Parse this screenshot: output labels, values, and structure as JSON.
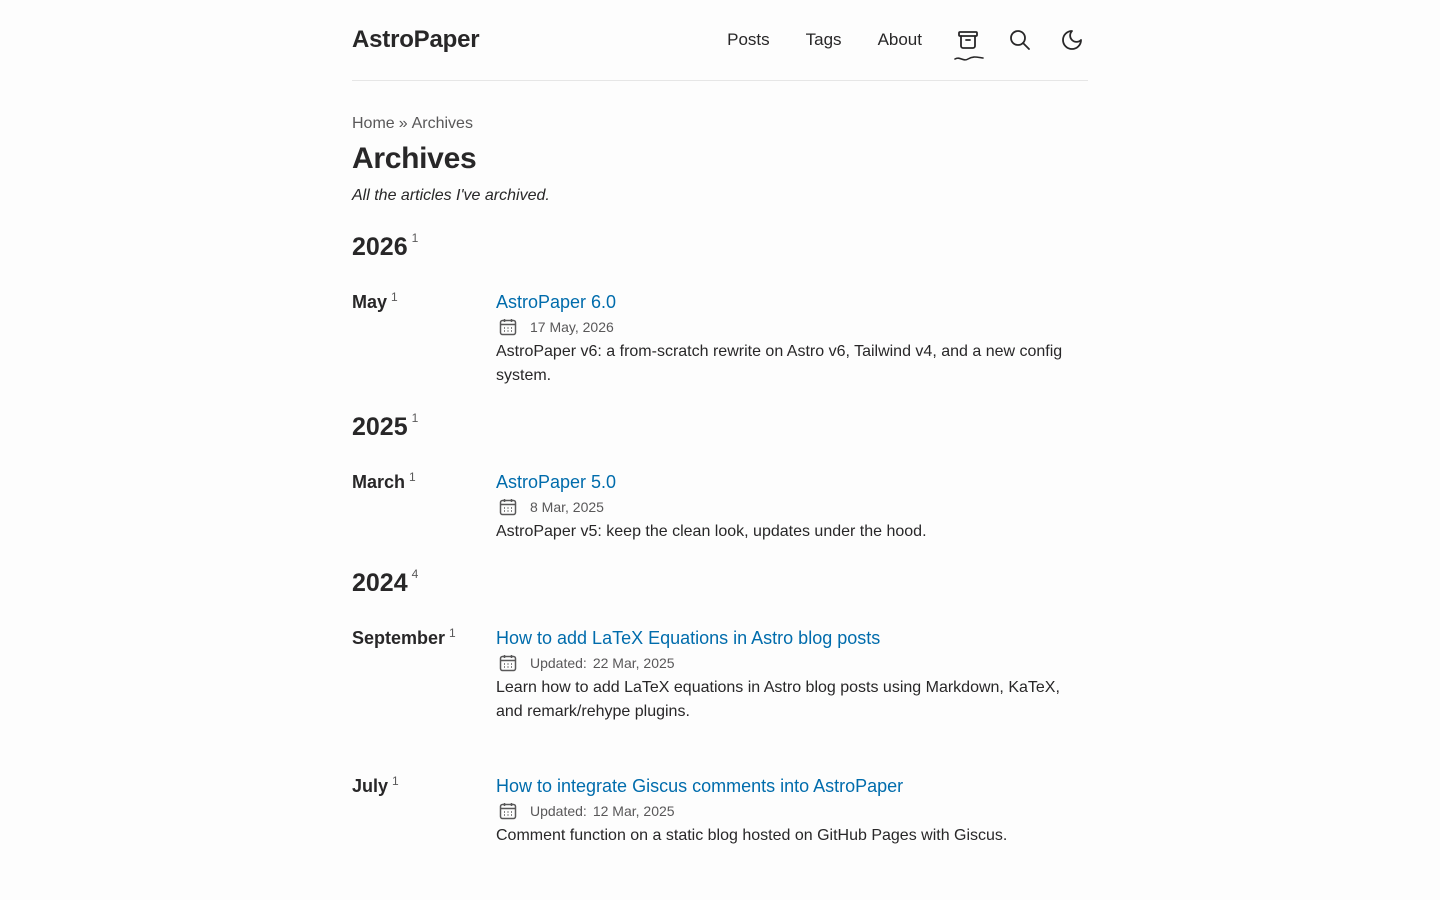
{
  "header": {
    "logo": "AstroPaper",
    "nav": {
      "posts": "Posts",
      "tags": "Tags",
      "about": "About"
    },
    "icons": [
      "archive-icon",
      "search-icon",
      "moon-icon"
    ]
  },
  "breadcrumb": {
    "home": "Home",
    "separator": "»",
    "current": "Archives"
  },
  "page": {
    "title": "Archives",
    "description": "All the articles I've archived."
  },
  "archives": [
    {
      "year": "2026",
      "year_count": "1",
      "months": [
        {
          "month": "May",
          "count": "1",
          "posts": [
            {
              "title": "AstroPaper 6.0",
              "updated_label": "",
              "date": "17 May, 2026",
              "description": "AstroPaper v6: a from-scratch rewrite on Astro v6, Tailwind v4, and a new config system."
            }
          ]
        }
      ]
    },
    {
      "year": "2025",
      "year_count": "1",
      "months": [
        {
          "month": "March",
          "count": "1",
          "posts": [
            {
              "title": "AstroPaper 5.0",
              "updated_label": "",
              "date": "8 Mar, 2025",
              "description": "AstroPaper v5: keep the clean look, updates under the hood."
            }
          ]
        }
      ]
    },
    {
      "year": "2024",
      "year_count": "4",
      "months": [
        {
          "month": "September",
          "count": "1",
          "posts": [
            {
              "title": "How to add LaTeX Equations in Astro blog posts",
              "updated_label": "Updated:",
              "date": "22 Mar, 2025",
              "description": "Learn how to add LaTeX equations in Astro blog posts using Markdown, KaTeX, and remark/rehype plugins."
            }
          ]
        },
        {
          "month": "July",
          "count": "1",
          "posts": [
            {
              "title": "How to integrate Giscus comments into AstroPaper",
              "updated_label": "Updated:",
              "date": "12 Mar, 2025",
              "description": "Comment function on a static blog hosted on GitHub Pages with Giscus."
            }
          ]
        }
      ]
    }
  ],
  "colors": {
    "background": "#fdfdfd",
    "text": "#282728",
    "accent": "#006cac",
    "muted": "#595859"
  }
}
